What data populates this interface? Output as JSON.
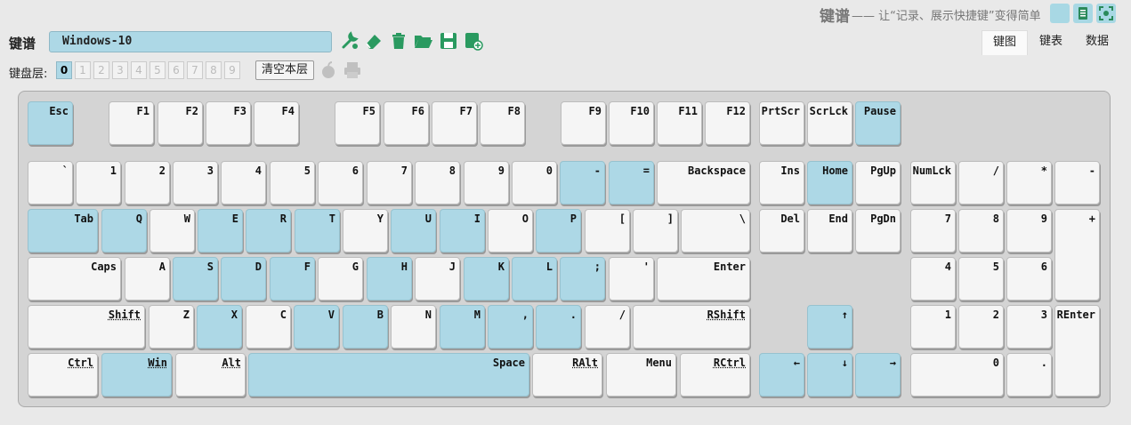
{
  "brand": {
    "title": "键谱",
    "subtitle": "—— 让“记录、展示快捷键”变得简单"
  },
  "header": {
    "label": "键谱",
    "layout_name": "Windows-10"
  },
  "tabs": [
    "键图",
    "键表",
    "数据"
  ],
  "layer_bar": {
    "label": "键盘层:",
    "layers": [
      "0",
      "1",
      "2",
      "3",
      "4",
      "5",
      "6",
      "7",
      "8",
      "9"
    ],
    "active": "0",
    "clear_label": "清空本层"
  },
  "colors": {
    "highlight": "#add8e6",
    "key": "#f5f5f5",
    "board": "#d4d4d4"
  },
  "keys": {
    "esc": "Esc",
    "f1": "F1",
    "f2": "F2",
    "f3": "F3",
    "f4": "F4",
    "f5": "F5",
    "f6": "F6",
    "f7": "F7",
    "f8": "F8",
    "f9": "F9",
    "f10": "F10",
    "f11": "F11",
    "f12": "F12",
    "prtscr": "PrtScr",
    "scrlck": "ScrLck",
    "pause": "Pause",
    "grave": "`",
    "n1": "1",
    "n2": "2",
    "n3": "3",
    "n4": "4",
    "n5": "5",
    "n6": "6",
    "n7": "7",
    "n8": "8",
    "n9": "9",
    "n0": "0",
    "minus": "-",
    "equal": "=",
    "backspace": "Backspace",
    "ins": "Ins",
    "home": "Home",
    "pgup": "PgUp",
    "numlck": "NumLck",
    "kp_div": "/",
    "kp_mul": "*",
    "kp_sub": "-",
    "tab": "Tab",
    "q": "Q",
    "w": "W",
    "e": "E",
    "r": "R",
    "t": "T",
    "y": "Y",
    "u": "U",
    "i": "I",
    "o": "O",
    "p": "P",
    "lbracket": "[",
    "rbracket": "]",
    "backslash": "\\",
    "del": "Del",
    "end": "End",
    "pgdn": "PgDn",
    "kp7": "7",
    "kp8": "8",
    "kp9": "9",
    "kp_add": "+",
    "caps": "Caps",
    "a": "A",
    "s": "S",
    "d": "D",
    "f": "F",
    "g": "G",
    "h": "H",
    "j": "J",
    "k": "K",
    "l": "L",
    "semicolon": ";",
    "quote": "'",
    "enter": "Enter",
    "kp4": "4",
    "kp5": "5",
    "kp6": "6",
    "lshift": "Shift",
    "z": "Z",
    "x": "X",
    "c": "C",
    "v": "V",
    "b": "B",
    "n": "N",
    "m": "M",
    "comma": ",",
    "period": ".",
    "slash": "/",
    "rshift": "RShift",
    "up": "↑",
    "kp1": "1",
    "kp2": "2",
    "kp3": "3",
    "kp_enter": "REnter",
    "lctrl": "Ctrl",
    "win": "Win",
    "lalt": "Alt",
    "space": "Space",
    "ralt": "RAlt",
    "menu": "Menu",
    "rctrl": "RCtrl",
    "left": "←",
    "down": "↓",
    "right": "→",
    "kp0": "0",
    "kp_dot": "."
  },
  "highlighted": [
    "esc",
    "pause",
    "minus",
    "equal",
    "home",
    "tab",
    "q",
    "e",
    "r",
    "t",
    "u",
    "i",
    "p",
    "s",
    "d",
    "f",
    "h",
    "k",
    "l",
    "semicolon",
    "x",
    "v",
    "b",
    "m",
    "comma",
    "period",
    "up",
    "win",
    "space",
    "left",
    "down",
    "right"
  ]
}
